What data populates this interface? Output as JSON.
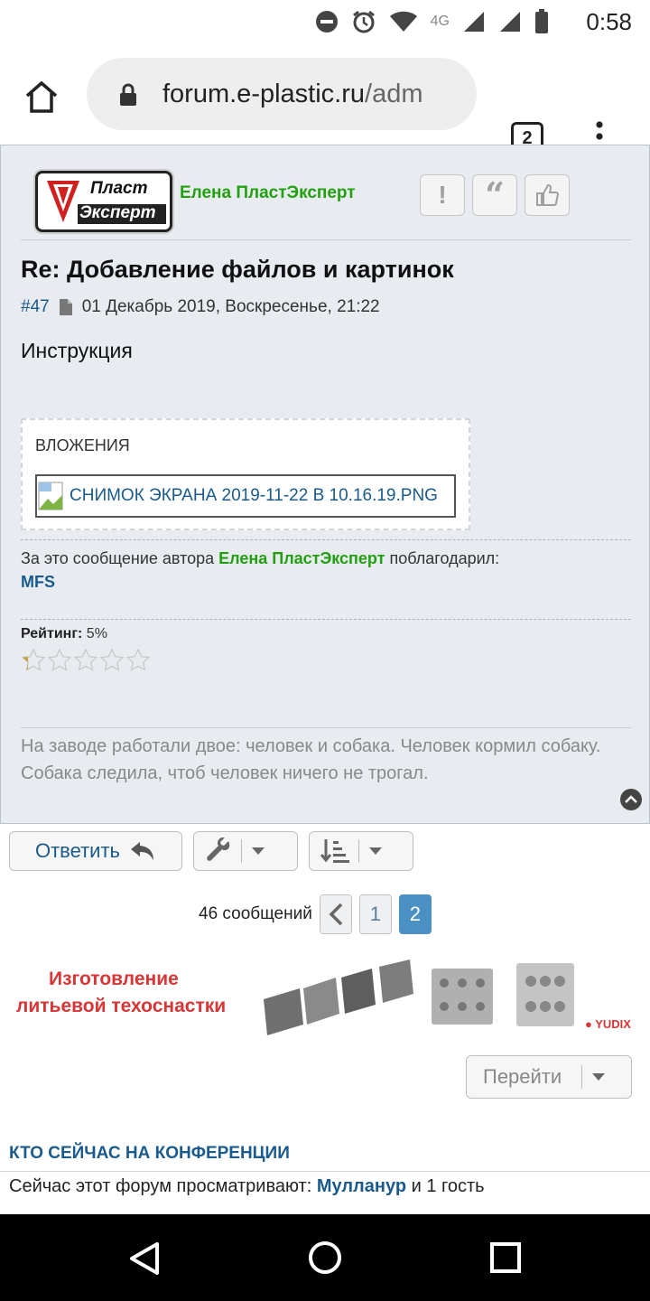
{
  "status_bar": {
    "time": "0:58",
    "network": "4G",
    "icons": [
      "dnd-icon",
      "alarm-icon",
      "wifi-icon",
      "signal-icon",
      "battery-icon"
    ]
  },
  "browser": {
    "url_host": "forum.e-plastic.ru",
    "url_path": "/adm",
    "tab_count": "2"
  },
  "post": {
    "avatar_text_1": "Пласт",
    "avatar_text_2": "Эксперт",
    "author": "Елена ПластЭксперт",
    "title": "Re: Добавление файлов и картинок",
    "number": "#47",
    "date": "01 Декабрь 2019, Воскресенье, 21:22",
    "body": "Инструкция",
    "attachments_label": "ВЛОЖЕНИЯ",
    "attachment_file": "СНИМОК ЭКРАНА 2019-11-22 В 10.16.19.PNG",
    "thanks_prefix": "За это сообщение автора",
    "thanks_author": "Елена ПластЭксперт",
    "thanks_suffix": "поблагодарил:",
    "thanks_user": "MFS",
    "rating_label": "Рейтинг:",
    "rating_value": "5%",
    "rating_fraction": 0.05,
    "signature": "На заводе работали двое: человек и собака. Человек кормил собаку. Собака следила, чтоб человек ничего не трогал."
  },
  "actions": {
    "reply_label": "Ответить"
  },
  "pagination": {
    "count_text": "46 сообщений",
    "pages": [
      "1",
      "2"
    ],
    "current": "2"
  },
  "banner": {
    "line1": "Изготовление",
    "line2": "литьевой техоснастки",
    "brand": "YUDIX"
  },
  "goto_label": "Перейти",
  "online": {
    "heading": "КТО СЕЙЧАС НА КОНФЕРЕНЦИИ",
    "prefix": "Сейчас этот форум просматривают:",
    "user": "Мулланур",
    "suffix": "и 1 гость"
  },
  "colors": {
    "link": "#1a5a8c",
    "author_green": "#22a010",
    "active_page": "#4a90c2",
    "banner_red": "#d93535"
  }
}
